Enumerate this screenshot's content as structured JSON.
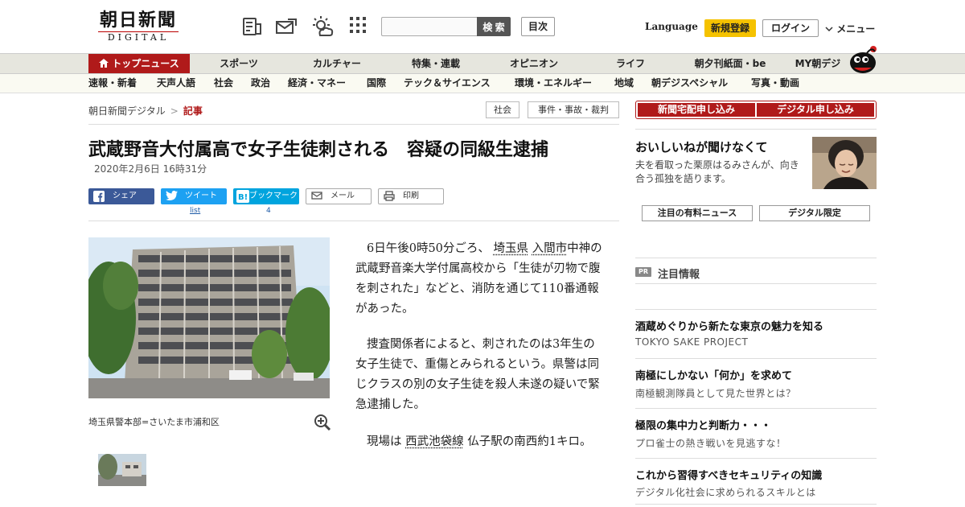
{
  "header": {
    "logo_main": "朝日新聞",
    "logo_sub": "DIGITAL",
    "search_placeholder": "",
    "search_label": "検 索",
    "contents_label": "目次",
    "language_label": "Language",
    "signup_label": "新規登録",
    "login_label": "ログイン",
    "menu_label": "メニュー"
  },
  "icons": {
    "header": [
      "newspaper-icon",
      "mail-icon",
      "weather-icon",
      "grid-icon"
    ],
    "accent": "#b01a1a",
    "gold": "#f5c200"
  },
  "nav_primary": [
    {
      "label": "トップニュース",
      "active": true
    },
    {
      "label": "スポーツ"
    },
    {
      "label": "カルチャー"
    },
    {
      "label": "特集・連載"
    },
    {
      "label": "オピニオン"
    },
    {
      "label": "ライフ"
    },
    {
      "label": "朝夕刊紙面・be"
    },
    {
      "label": "MY朝デジ"
    }
  ],
  "nav_secondary": [
    {
      "label": "速報・新着"
    },
    {
      "label": "天声人語"
    },
    {
      "label": "社会"
    },
    {
      "label": "政治"
    },
    {
      "label": "経済・マネー"
    },
    {
      "label": "国際"
    },
    {
      "label": "テック＆サイエンス"
    },
    {
      "label": "環境・エネルギー"
    },
    {
      "label": "地域"
    },
    {
      "label": "朝デジスペシャル"
    },
    {
      "label": "写真・動画"
    }
  ],
  "breadcrumb": {
    "home": "朝日新聞デジタル",
    "separator": ">",
    "current": "記事"
  },
  "tags": [
    "社会",
    "事件・事故・裁判"
  ],
  "article": {
    "headline": "武蔵野音大付属高で女子生徒刺される　容疑の同級生逮捕",
    "date": "2020年2月6日 16時31分",
    "share": {
      "facebook": "シェア",
      "twitter": "ツイート",
      "twitter_count": "list",
      "hatena": "ブックマーク",
      "hatena_count": "4",
      "mail": "メール",
      "print": "印刷"
    },
    "photo_caption": "埼玉県警本部=さいたま市浦和区",
    "p1": {
      "pre": "6日午後0時50分ごろ、",
      "link1": "埼玉県",
      "link2": "入間市",
      "post": "中神の武蔵野音楽大学付属高校から「生徒が刃物で腹を刺された」などと、消防を通じて110番通報があった。"
    },
    "p2": "捜査関係者によると、刺されたのは3年生の女子生徒で、重傷とみられるという。県警は同じクラスの別の女子生徒を殺人未遂の疑いで緊急逮捕した。",
    "p3": {
      "pre": "現場は",
      "link": "西武池袋線",
      "post": "仏子駅の南西約1キロ。"
    }
  },
  "sidebar": {
    "subscribe_paper": "新聞宅配申し込み",
    "subscribe_digital": "デジタル申し込み",
    "feature_title": "おいしいねが聞けなくて",
    "feature_desc": "夫を看取った栗原はるみさんが、向き合う孤独を語ります。",
    "tab_paid": "注目の有料ニュース",
    "tab_digital": "デジタル限定",
    "pr_badge": "PR",
    "pr_label": "注目情報",
    "pr_items": [
      {
        "title": "酒蔵めぐりから新たな東京の魅力を知る",
        "sub": "TOKYO SAKE PROJECT"
      },
      {
        "title": "南極にしかない「何か」を求めて",
        "sub": "南極観測隊員として見た世界とは？"
      },
      {
        "title": "極限の集中力と判断力・・・",
        "sub": "プロ雀士の熱き戦いを見逃すな！"
      },
      {
        "title": "これから習得すべきセキュリティの知識",
        "sub": "デジタル化社会に求められるスキルとは"
      }
    ]
  }
}
